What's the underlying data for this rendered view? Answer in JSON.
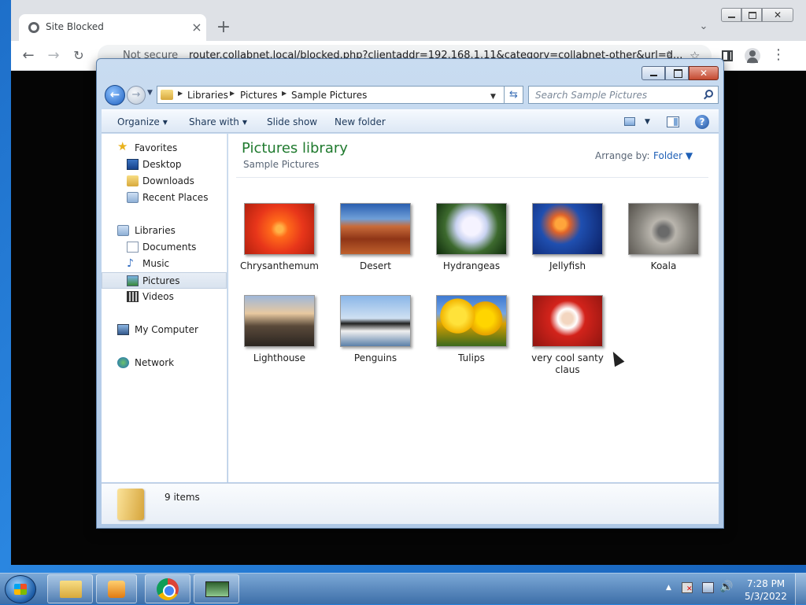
{
  "browser": {
    "tab_title": "Site Blocked",
    "tab_close": "×",
    "new_tab": "+",
    "tab_search": "⌄",
    "close_glyph": "✕",
    "back": "←",
    "forward": "→",
    "reload": "↻",
    "not_secure": "Not secure",
    "url": "router.collabnet.local/blocked.php?clientaddr=192.168.1.11&category=collabnet-other&url=d...",
    "share_glyph": "⇪",
    "star_glyph": "☆",
    "menu_glyph": "⋮"
  },
  "explorer": {
    "close_glyph": "✕",
    "back_glyph": "←",
    "forward_glyph": "→",
    "dropdown_glyph": "▼",
    "refresh_glyph": "⇆",
    "breadcrumb": [
      "Libraries",
      "Pictures",
      "Sample Pictures"
    ],
    "breadcrumb_sep": "▶",
    "search_placeholder": "Search Sample Pictures",
    "commands": {
      "organize": "Organize",
      "share_with": "Share with",
      "slide_show": "Slide show",
      "new_folder": "New folder",
      "caret": "▼",
      "help": "?"
    },
    "nav": {
      "favorites": "Favorites",
      "desktop": "Desktop",
      "downloads": "Downloads",
      "recent_places": "Recent Places",
      "libraries": "Libraries",
      "documents": "Documents",
      "music": "Music",
      "pictures": "Pictures",
      "videos": "Videos",
      "my_computer": "My Computer",
      "network": "Network",
      "star_glyph": "★",
      "music_glyph": "♪"
    },
    "library_title": "Pictures library",
    "library_subtitle": "Sample Pictures",
    "arrange_label": "Arrange by:",
    "arrange_value": "Folder ▼",
    "items": [
      "Chrysanthemum",
      "Desert",
      "Hydrangeas",
      "Jellyfish",
      "Koala",
      "Lighthouse",
      "Penguins",
      "Tulips",
      "very cool santy claus"
    ],
    "item_count": "9 items"
  },
  "taskbar": {
    "tray_arrow": "▲",
    "volume_glyph": "🔊",
    "time": "7:28 PM",
    "date": "5/3/2022"
  }
}
